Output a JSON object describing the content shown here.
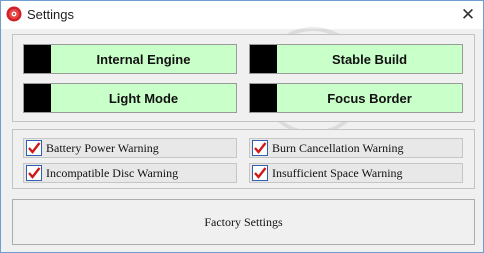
{
  "window": {
    "title": "Settings",
    "close_glyph": "✕"
  },
  "toggles": [
    {
      "label": "Internal Engine",
      "state_color": "#000000",
      "bg": "#c9ffc9"
    },
    {
      "label": "Stable Build",
      "state_color": "#000000",
      "bg": "#c9ffc9"
    },
    {
      "label": "Light Mode",
      "state_color": "#000000",
      "bg": "#c9ffc9"
    },
    {
      "label": "Focus Border",
      "state_color": "#000000",
      "bg": "#c9ffc9"
    }
  ],
  "checkboxes": [
    {
      "label": "Battery Power Warning",
      "checked": true
    },
    {
      "label": "Burn Cancellation Warning",
      "checked": true
    },
    {
      "label": "Incompatible Disc Warning",
      "checked": true
    },
    {
      "label": "Insufficient Space Warning",
      "checked": true
    }
  ],
  "factory_button": {
    "label": "Factory Settings"
  },
  "icons": {
    "app": "disc-icon",
    "close": "close-icon",
    "check": "checkmark-icon"
  }
}
